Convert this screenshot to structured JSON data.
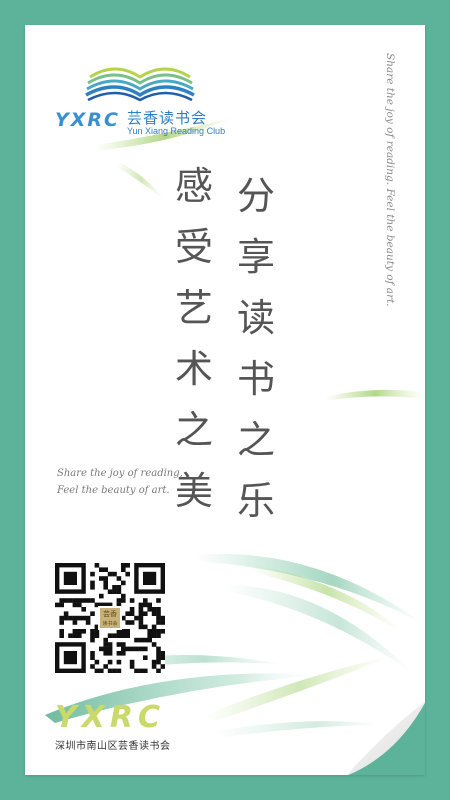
{
  "logo": {
    "mark": "YXRC",
    "name_cn": "芸香读书会",
    "name_en": "Yun Xiang Reading Club"
  },
  "side_text": "Share the joy of reading. Feel the beauty of art.",
  "columns": {
    "left": [
      "感",
      "受",
      "艺",
      "术",
      "之",
      "美"
    ],
    "right": [
      "分",
      "享",
      "读",
      "书",
      "之",
      "乐"
    ]
  },
  "quote": {
    "line1": "Share the joy of reading,",
    "line2": "Feel the beauty of art."
  },
  "qr": {
    "badge_line1": "芸香",
    "badge_line2": "读书会"
  },
  "footer": {
    "mark": "YXRC",
    "org": "深圳市南山区芸香读书会"
  },
  "colors": {
    "background": "#5db39a",
    "brand_blue": "#3a8fd1",
    "brand_lime": "#c9d96a"
  }
}
